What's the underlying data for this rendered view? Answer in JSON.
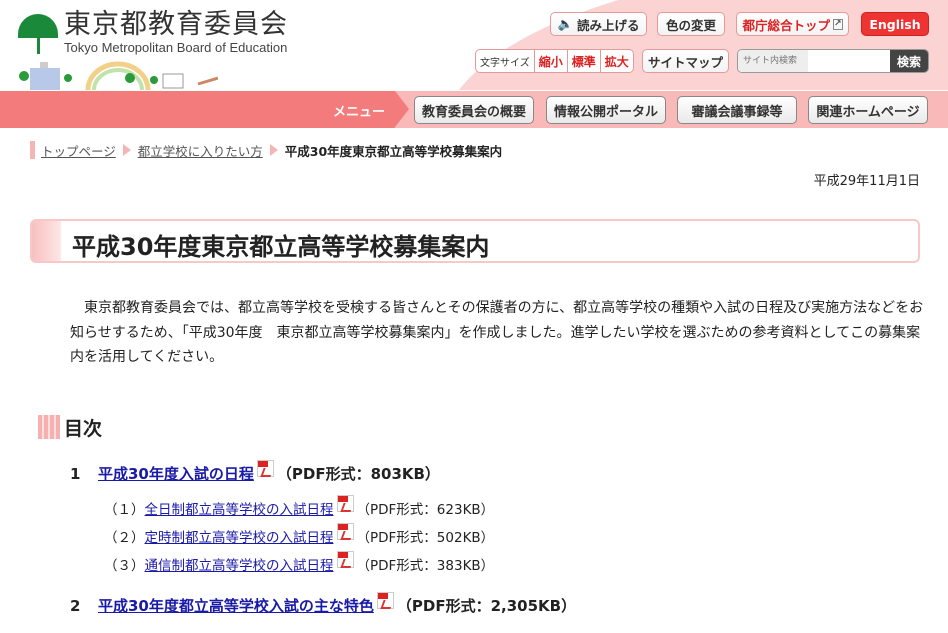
{
  "header": {
    "logo_jp": "東京都教育委員会",
    "logo_en": "Tokyo Metropolitan Board of Education",
    "read_aloud": "読み上げる",
    "color_change": "色の変更",
    "metro_top": "都庁総合トップ",
    "english": "English",
    "font_size_label": "文字サイズ",
    "font_small": "縮小",
    "font_normal": "標準",
    "font_large": "拡大",
    "sitemap": "サイトマップ",
    "search_placeholder": "サイト内検索",
    "search_button": "検索"
  },
  "nav": {
    "menu": "メニュー",
    "items": [
      "教育委員会の概要",
      "情報公開ポータル",
      "審議会議事録等",
      "関連ホームページ"
    ]
  },
  "breadcrumb": {
    "items": [
      "トップページ",
      "都立学校に入りたい方"
    ],
    "current": "平成30年度東京都立高等学校募集案内"
  },
  "date": "平成29年11月1日",
  "title": "平成30年度東京都立高等学校募集案内",
  "intro": "東京都教育委員会では、都立高等学校を受検する皆さんとその保護者の方に、都立高等学校の種類や入試の日程及び実施方法などをお知らせするため、「平成30年度　東京都立高等学校募集案内」を作成しました。進学したい学校を選ぶための参考資料としてこの募集案内を活用してください。",
  "toc": {
    "heading": "目次",
    "item1": {
      "num": "1",
      "link": "平成30年度入試の日程",
      "info": "（PDF形式：803KB）"
    },
    "sub": [
      {
        "num": "（１）",
        "link": "全日制都立高等学校の入試日程",
        "info": "（PDF形式：623KB）"
      },
      {
        "num": "（２）",
        "link": "定時制都立高等学校の入試日程",
        "info": "（PDF形式：502KB）"
      },
      {
        "num": "（３）",
        "link": "通信制都立高等学校の入試日程",
        "info": "（PDF形式：383KB）"
      }
    ],
    "item2": {
      "num": "2",
      "link": "平成30年度都立高等学校入試の主な特色",
      "info": "（PDF形式：2,305KB）"
    }
  }
}
